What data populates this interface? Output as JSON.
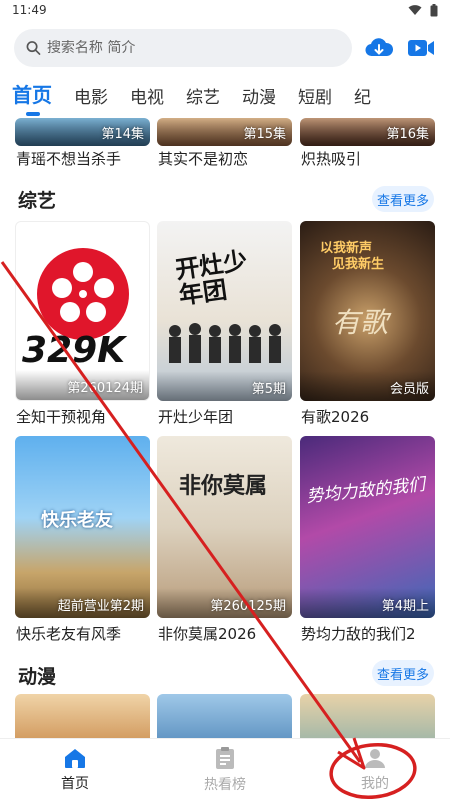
{
  "status": {
    "time": "11:49"
  },
  "search": {
    "placeholder": "搜索名称 简介"
  },
  "tabs": [
    {
      "label": "首页",
      "active": true
    },
    {
      "label": "电影"
    },
    {
      "label": "电视"
    },
    {
      "label": "综艺"
    },
    {
      "label": "动漫"
    },
    {
      "label": "短剧"
    },
    {
      "label": "纪"
    }
  ],
  "top_row": [
    {
      "badge": "第14集",
      "title": "青瑶不想当杀手"
    },
    {
      "badge": "第15集",
      "title": "其实不是初恋"
    },
    {
      "badge": "第16集",
      "title": "炽热吸引"
    }
  ],
  "variety": {
    "title": "综艺",
    "more": "查看更多",
    "items": [
      {
        "badge": "第260124期",
        "title": "全知干预视角",
        "logo_text": "329K"
      },
      {
        "badge": "第5期",
        "title": "开灶少年团",
        "art_text": "开灶少年团"
      },
      {
        "badge": "会员版",
        "title": "有歌2026",
        "art_text": "有歌",
        "tagline1": "以我新声",
        "tagline2": "见我新生"
      },
      {
        "badge": "超前营业第2期",
        "title": "快乐老友有风季",
        "art_text": "快乐老友"
      },
      {
        "badge": "第260125期",
        "title": "非你莫属2026",
        "art_text": "非你莫属"
      },
      {
        "badge": "第4期上",
        "title": "势均力敌的我们2",
        "art_text": "势均力敌的我们"
      }
    ]
  },
  "anime": {
    "title": "动漫",
    "more": "查看更多"
  },
  "bottom_nav": [
    {
      "label": "首页",
      "icon": "home-icon",
      "active": true
    },
    {
      "label": "热看榜",
      "icon": "clipboard-icon"
    },
    {
      "label": "我的",
      "icon": "profile-icon"
    }
  ],
  "colors": {
    "accent": "#1677e6",
    "annotation_red": "#d62020"
  }
}
